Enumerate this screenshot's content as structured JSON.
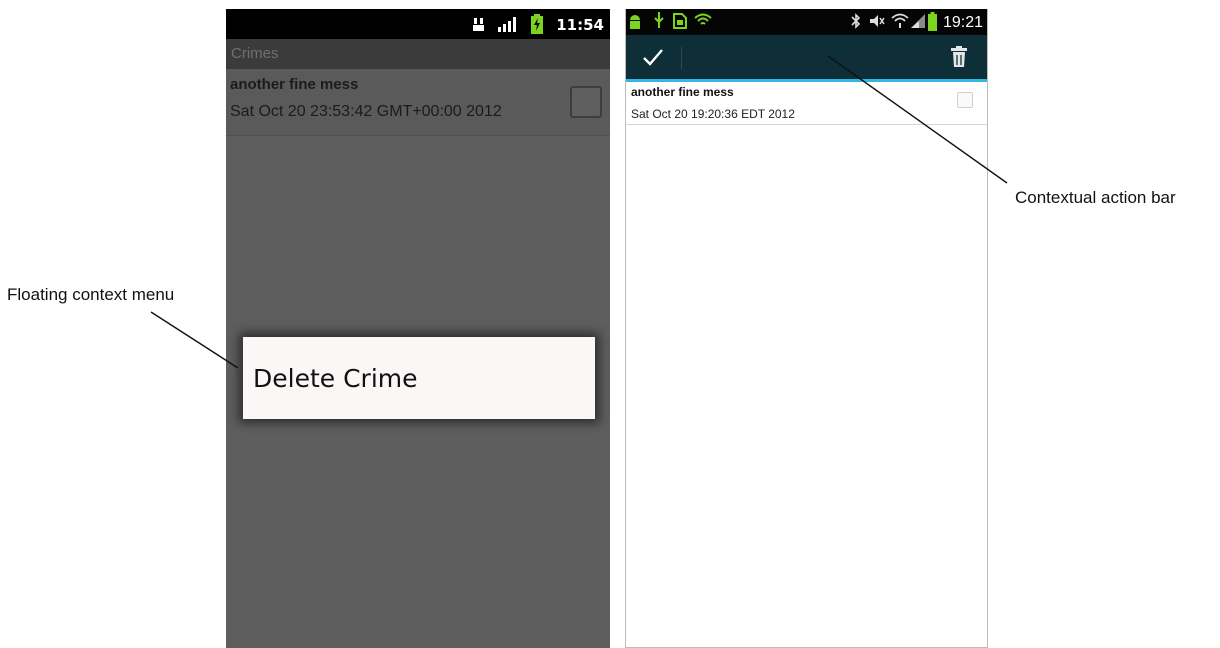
{
  "left_phone": {
    "status_time": "11:54",
    "app_title": "Crimes",
    "crime": {
      "title": "another fine mess",
      "date": "Sat Oct 20 23:53:42 GMT+00:00 2012",
      "solved": false
    },
    "context_menu": {
      "items": [
        "Delete Crime"
      ]
    }
  },
  "right_phone": {
    "status_time": "19:21",
    "action_bar": {
      "done_icon": "checkmark-icon",
      "delete_icon": "trash-icon",
      "accent_color": "#33b5e5",
      "background_color": "#0e2f38"
    },
    "crime": {
      "title": "another fine mess",
      "date": "Sat Oct 20 19:20:36 EDT 2012",
      "solved": false
    }
  },
  "callouts": {
    "contextual_action_bar": "Contextual action bar",
    "floating_context_menu": "Floating context menu"
  }
}
